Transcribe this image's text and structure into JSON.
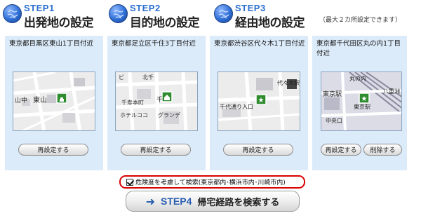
{
  "steps": [
    {
      "num": "STEP1",
      "title": "出発地の設定"
    },
    {
      "num": "STEP2",
      "title": "目的地の設定"
    },
    {
      "num": "STEP3",
      "title": "経由地の設定"
    }
  ],
  "waypoint_note": "（最大２カ所設定できます）",
  "panels": [
    {
      "address": "東京都目黒区東山1丁目付近",
      "map_labels": [
        "山中",
        "東山"
      ],
      "reset_label": "再設定する"
    },
    {
      "address": "東京都足立区千住3丁目付近",
      "map_labels": [
        "ビ",
        "北千",
        "千寿本町",
        "千",
        "ホテルココ",
        "グランデ"
      ],
      "reset_label": "再設定する"
    },
    {
      "address": "東京都渋谷区代々木1丁目付近",
      "map_labels": [
        "代々木駅",
        "千代通り入口"
      ],
      "reset_label": "再設定する"
    },
    {
      "address": "東京都千代田区丸の内1丁目付近",
      "map_labels": [
        "丸の内",
        "東京駅",
        "八重洲",
        "東京駅",
        "中央口"
      ],
      "reset_label": "再設定する",
      "delete_label": "削除する"
    }
  ],
  "risk_checkbox": {
    "checked": true,
    "label": "危険度を考慮して検索(東京都内･横浜市内･川崎市内)"
  },
  "search_button": {
    "arrow_icon": "arrow-right-icon",
    "step": "STEP4",
    "label": "帰宅経路を検索する"
  },
  "colors": {
    "accent": "#2b6fd0",
    "panel_bg": "#dcebfa",
    "highlight": "#d90000",
    "marker": "#2e8b2e"
  }
}
